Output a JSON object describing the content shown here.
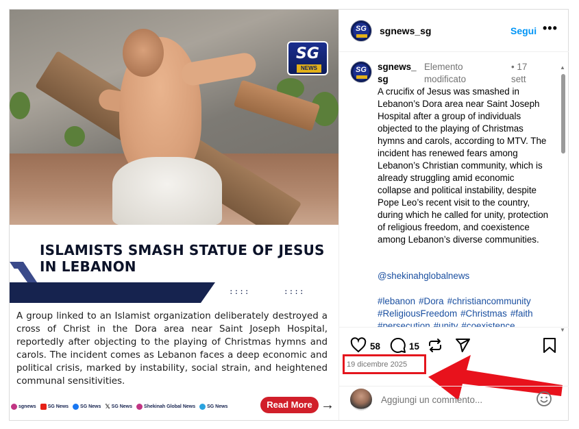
{
  "post": {
    "logo": {
      "sg": "SG",
      "news": "NEWS"
    },
    "headline": "ISLAMISTS SMASH STATUE OF JESUS IN LEBANON",
    "decor_dots_1": "::::",
    "decor_dots_2": "::::",
    "body": "A group linked to an Islamist organization deliberately destroyed a cross of Christ in the Dora area near Saint Joseph Hospital, reportedly after objecting to the playing of Christmas hymns and carols. The incident comes as Lebanon faces a deep economic and political crisis, marked by instability, social strain, and heightened communal sensitivities.",
    "footer": [
      {
        "icon": "instagram-icon",
        "label": "sgnews",
        "color": "#c13584"
      },
      {
        "icon": "youtube-icon",
        "label": "SG News",
        "color": "#e62117"
      },
      {
        "icon": "facebook-icon",
        "label": "SG News",
        "color": "#1877f2"
      },
      {
        "icon": "x-icon",
        "label": "SG News",
        "color": "#000000"
      },
      {
        "icon": "instagram-icon",
        "label": "Shekinah Global News",
        "color": "#c13584"
      },
      {
        "icon": "telegram-icon",
        "label": "SG News",
        "color": "#2aa3df"
      }
    ],
    "read_more": "Read More"
  },
  "header": {
    "username": "sgnews_sg",
    "follow": "Segui",
    "more": "•••"
  },
  "comment": {
    "username": "sgnews_sg",
    "edited": "Elemento modificato",
    "time": "• 17 sett",
    "text": "A crucifix of Jesus was smashed in Lebanon’s Dora area near Saint Joseph Hospital after a group of individuals objected to the playing of Christmas hymns and carols, according to MTV. The incident has renewed fears among Lebanon’s Christian community, which is already struggling amid economic collapse and political instability, despite Pope Leo’s recent visit to the country, during which he called for unity, protection of religious freedom, and coexistence among Lebanon’s diverse communities.",
    "mention": "@shekinahglobalnews",
    "hashtags": [
      "#lebanon",
      "#Dora",
      "#christiancommunity",
      "#ReligiousFreedom",
      "#Christmas",
      "#faith",
      "#persecution",
      "#unity",
      "#coexistence"
    ]
  },
  "actions": {
    "likes": "58",
    "comments": "15"
  },
  "date": "19 dicembre 2025",
  "add_comment": {
    "placeholder": "Aggiungi un commento..."
  },
  "colors": {
    "accent_blue": "#0095f6",
    "highlight_red": "#e4151d",
    "navy": "#16234f"
  }
}
